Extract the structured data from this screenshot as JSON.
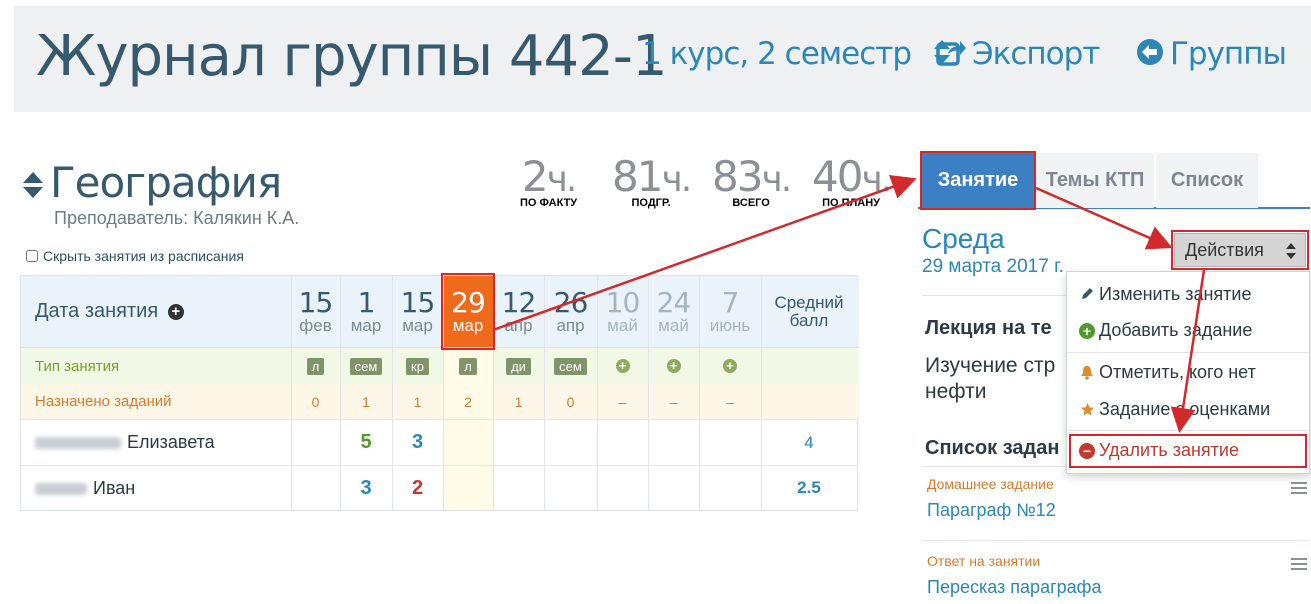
{
  "header": {
    "title": "Журнал группы 442-1",
    "course_selector": "1 курс, 2 семестр",
    "export_label": "Экспорт",
    "groups_label": "Группы"
  },
  "subject": {
    "name": "География",
    "teacher": "Преподаватель: Калякин К.А.",
    "hide_checkbox_label": "Скрыть занятия из расписания",
    "hide_checked": false
  },
  "hours": [
    {
      "value": "2",
      "unit": "ч.",
      "caption": "ПО ФАКТУ"
    },
    {
      "value": "81",
      "unit": "ч.",
      "caption": "ПОДГР."
    },
    {
      "value": "83",
      "unit": "ч.",
      "caption": "ВСЕГО"
    },
    {
      "value": "40",
      "unit": "ч.",
      "caption": "ПО ПЛАНУ"
    }
  ],
  "journal": {
    "date_header": "Дата занятия",
    "avg_header_line1": "Средний",
    "avg_header_line2": "балл",
    "type_label": "Тип занятия",
    "tasks_label": "Назначено заданий",
    "dates": [
      {
        "day": "15",
        "month": "фев",
        "type": "л",
        "tasks": "0",
        "future": false,
        "active": false
      },
      {
        "day": "1",
        "month": "мар",
        "type": "сем",
        "tasks": "1",
        "future": false,
        "active": false
      },
      {
        "day": "15",
        "month": "мар",
        "type": "кр",
        "tasks": "1",
        "future": false,
        "active": false
      },
      {
        "day": "29",
        "month": "мар",
        "type": "л",
        "tasks": "2",
        "future": false,
        "active": true
      },
      {
        "day": "12",
        "month": "апр",
        "type": "ди",
        "tasks": "1",
        "future": false,
        "active": false
      },
      {
        "day": "26",
        "month": "апр",
        "type": "сем",
        "tasks": "0",
        "future": false,
        "active": false
      },
      {
        "day": "10",
        "month": "май",
        "type": "+",
        "tasks": "–",
        "future": true,
        "active": false
      },
      {
        "day": "24",
        "month": "май",
        "type": "+",
        "tasks": "–",
        "future": true,
        "active": false
      },
      {
        "day": "7",
        "month": "июнь",
        "type": "+",
        "tasks": "–",
        "future": true,
        "active": false
      }
    ],
    "students": [
      {
        "name": "Елизавета",
        "grades": [
          "",
          "5",
          "3",
          "",
          "",
          "",
          "",
          "",
          ""
        ],
        "avg": "4"
      },
      {
        "name": "Иван",
        "grades": [
          "",
          "3",
          "2",
          "",
          "",
          "",
          "",
          "",
          ""
        ],
        "avg": "2.5"
      }
    ]
  },
  "panel": {
    "tabs": [
      "Занятие",
      "Темы КТП",
      "Список"
    ],
    "day_name": "Среда",
    "day_date": "29 марта 2017 г.",
    "lesson_heading": "Лекция на те",
    "lesson_text": "Изучение стр нефти",
    "tasks_heading": "Список задан",
    "tasks": [
      {
        "type": "Домашнее задание",
        "name": "Параграф №12"
      },
      {
        "type": "Ответ на занятии",
        "name": "Пересказ параграфа"
      }
    ]
  },
  "actions": {
    "button_label": "Действия",
    "items": [
      {
        "label": "Изменить занятие",
        "icon": "pencil-icon",
        "color": "#2b3a44"
      },
      {
        "label": "Добавить задание",
        "icon": "plus-circle-icon",
        "color": "#4e9a2e"
      },
      {
        "label": "Отметить, кого нет",
        "icon": "bell-icon",
        "color": "#e08a2a"
      },
      {
        "label": "Задание с оценками",
        "icon": "star-icon",
        "color": "#e08a2a"
      },
      {
        "label": "Удалить занятие",
        "icon": "minus-circle-icon",
        "color": "#c0392b"
      }
    ]
  },
  "colors": {
    "accent": "#2a87b8",
    "active_tab": "#3b7fc4",
    "active_date": "#f06a1c",
    "annotation_red": "#d22a2a"
  }
}
